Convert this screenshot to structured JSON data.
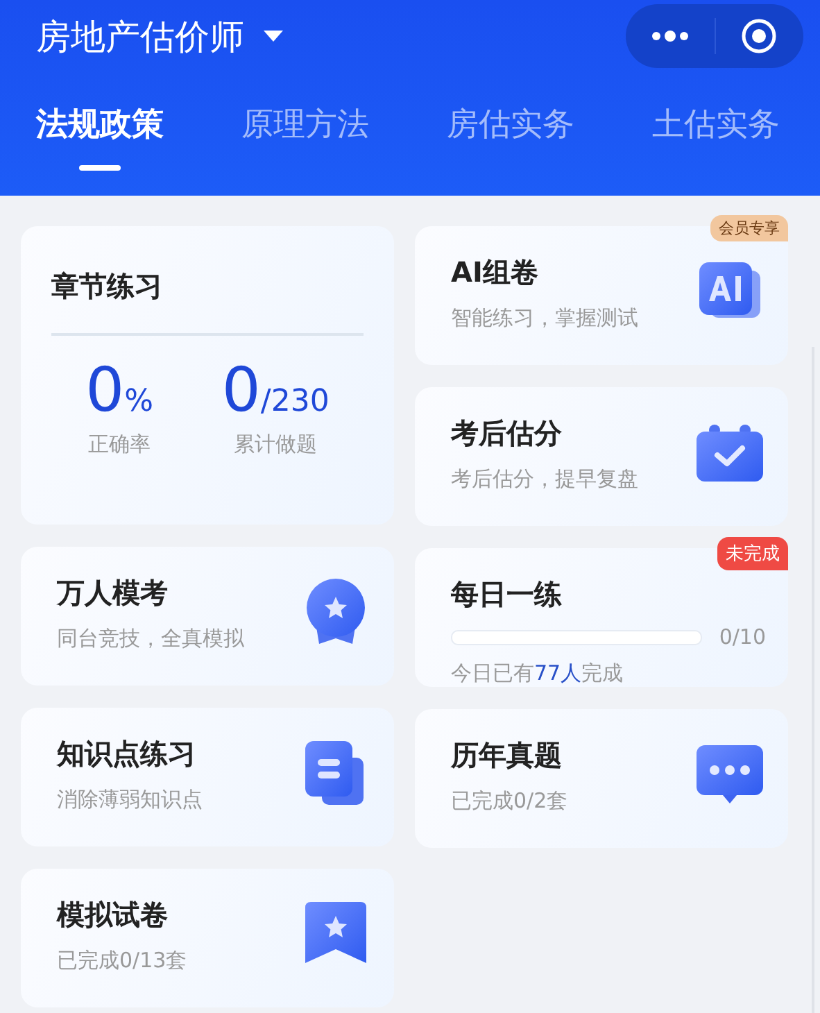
{
  "header": {
    "title": "房地产估价师",
    "tabs": [
      {
        "label": "法规政策",
        "selected": true
      },
      {
        "label": "原理方法",
        "selected": false
      },
      {
        "label": "房估实务",
        "selected": false
      },
      {
        "label": "土估实务",
        "selected": false
      }
    ]
  },
  "left_column": [
    {
      "kind": "stats",
      "title": "章节练习",
      "stats": [
        {
          "value": "0",
          "unit": "%",
          "label": "正确率"
        },
        {
          "value": "0",
          "unit": "/230",
          "label": "累计做题"
        }
      ]
    },
    {
      "kind": "feature",
      "title": "万人模考",
      "subtitle": "同台竞技，全真模拟"
    },
    {
      "kind": "feature",
      "title": "知识点练习",
      "subtitle": "消除薄弱知识点"
    },
    {
      "kind": "feature",
      "title": "模拟试卷",
      "subtitle": "已完成0/13套"
    }
  ],
  "right_column": [
    {
      "kind": "feature",
      "title": "AI组卷",
      "subtitle": "智能练习，掌握测试",
      "badge": {
        "text": "会员专享",
        "kind": "member"
      }
    },
    {
      "kind": "feature",
      "title": "考后估分",
      "subtitle": "考后估分，提早复盘"
    },
    {
      "kind": "progress",
      "title": "每日一练",
      "level": 0,
      "reading": "0/10",
      "subtitle": {
        "before": "今日已有",
        "highlight": "77人",
        "after": "完成"
      },
      "badge": {
        "text": "未完成",
        "kind": "todo"
      }
    },
    {
      "kind": "feature",
      "title": "历年真题",
      "subtitle": "已完成0/2套"
    }
  ]
}
